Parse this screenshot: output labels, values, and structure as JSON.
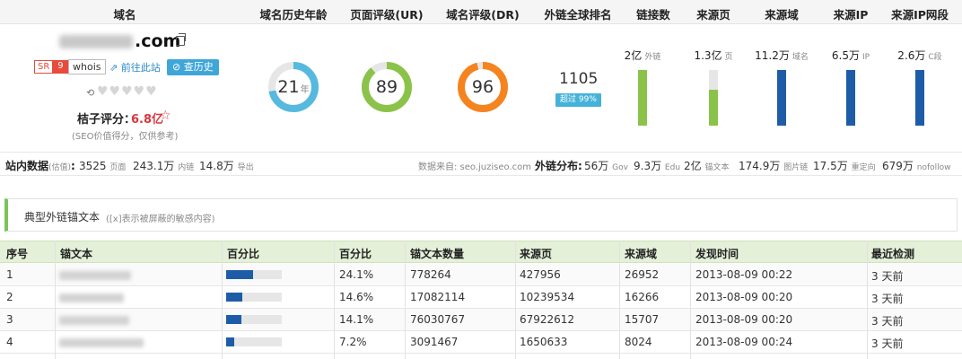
{
  "header": {
    "cols": [
      "域名",
      "域名历史年龄",
      "页面评级(UR)",
      "域名评级(DR)",
      "外链全球排名",
      "链接数",
      "来源页",
      "来源域",
      "来源IP",
      "来源IP网段"
    ]
  },
  "domain": {
    "suffix": ".com",
    "sr_label": "SR",
    "sr_value": "9",
    "whois": "whois",
    "visit": "前往此站",
    "history": "查历史",
    "hearts": "♥♥♥♥♥",
    "juzi_label": "桔子评分：",
    "juzi_value": "6.8亿",
    "juzi_note": "(SEO价值得分，仅供参考)"
  },
  "rings": {
    "age": {
      "value": "21",
      "unit": "年",
      "percent": 0.72,
      "color": "#56b9e0"
    },
    "ur": {
      "value": "89",
      "percent": 0.89,
      "color": "#8bc34a"
    },
    "dr": {
      "value": "96",
      "percent": 0.96,
      "color": "#f5841f"
    }
  },
  "rank": {
    "value": "1105",
    "badge": "超过 99%"
  },
  "metrics": [
    {
      "value": "2亿",
      "unit": "外链",
      "fill": 1.0,
      "color": "#8bc34a"
    },
    {
      "value": "1.3亿",
      "unit": "页",
      "fill": 0.65,
      "color": "#8bc34a"
    },
    {
      "value": "11.2万",
      "unit": "域名",
      "fill": 1.0,
      "color": "#1e5ca8"
    },
    {
      "value": "6.5万",
      "unit": "IP",
      "fill": 1.0,
      "color": "#1e5ca8"
    },
    {
      "value": "2.6万",
      "unit": "C段",
      "fill": 1.0,
      "color": "#1e5ca8"
    }
  ],
  "stats": {
    "site_label": "站内数据",
    "site_sub": "(估值)",
    "pages_v": "3525",
    "pages_u": "页面",
    "inner_v": "243.1万",
    "inner_u": "内链",
    "export_v": "14.8万",
    "export_u": "导出",
    "source": "数据来自: seo.juziseo.com",
    "dist_label": "外链分布:",
    "gov_v": "56万",
    "gov_u": "Gov",
    "edu_v": "9.3万",
    "edu_u": "Edu",
    "anchor_v": "2亿",
    "anchor_u": "锚文本",
    "img_v": "174.9万",
    "img_u": "图片链",
    "redir_v": "17.5万",
    "redir_u": "重定向",
    "nofollow_v": "679万",
    "nofollow_u": "nofollow"
  },
  "section": {
    "title": "典型外链锚文本",
    "note": "([x]表示被屏蔽的敏感内容)"
  },
  "table": {
    "headers": [
      "序号",
      "锚文本",
      "百分比",
      "百分比",
      "锚文本数量",
      "来源页",
      "来源域",
      "发现时间",
      "最近检测"
    ],
    "rows": [
      {
        "idx": "1",
        "pct": "24.1%",
        "frac": 0.241,
        "count": "778264",
        "pages": "427956",
        "domains": "26952",
        "time": "2013-08-09 00:22",
        "check": "3 天前"
      },
      {
        "idx": "2",
        "pct": "14.6%",
        "frac": 0.146,
        "count": "17082114",
        "pages": "10239534",
        "domains": "16266",
        "time": "2013-08-09 00:20",
        "check": "3 天前"
      },
      {
        "idx": "3",
        "pct": "14.1%",
        "frac": 0.141,
        "count": "76030767",
        "pages": "67922612",
        "domains": "15707",
        "time": "2013-08-09 00:20",
        "check": "3 天前"
      },
      {
        "idx": "4",
        "pct": "7.2%",
        "frac": 0.072,
        "count": "3091467",
        "pages": "1650633",
        "domains": "8024",
        "time": "2013-08-09 00:24",
        "check": "3 天前"
      }
    ]
  }
}
